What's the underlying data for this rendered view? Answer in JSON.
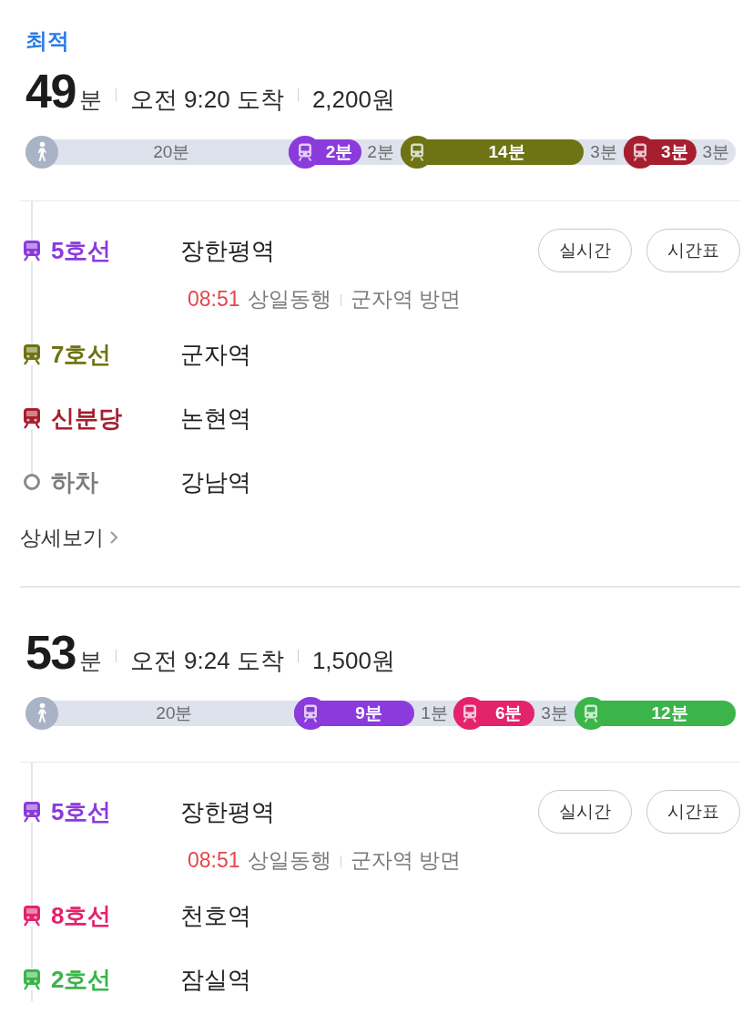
{
  "routes": [
    {
      "label": "최적",
      "duration": "49",
      "unit": "분",
      "arrival": "오전 9:20 도착",
      "fare": "2,200원",
      "segments": [
        {
          "kind": "walk",
          "time": "20분"
        },
        {
          "kind": "ride",
          "time": "2분",
          "color": "#8b3bdb"
        },
        {
          "kind": "transfer",
          "time": "2분"
        },
        {
          "kind": "ride",
          "time": "14분",
          "color": "#6e7314"
        },
        {
          "kind": "transfer",
          "time": "3분"
        },
        {
          "kind": "ride",
          "time": "3분",
          "color": "#a61f2e"
        },
        {
          "kind": "transfer",
          "time": "3분"
        }
      ],
      "steps": [
        {
          "kind": "board",
          "line": "5호선",
          "color": "#8b3bdb",
          "station": "장한평역",
          "detail": {
            "time": "08:51",
            "direction": "상일동행",
            "toward": "군자역 방면"
          },
          "buttons": [
            "실시간",
            "시간표"
          ]
        },
        {
          "kind": "board",
          "line": "7호선",
          "color": "#6e7314",
          "station": "군자역"
        },
        {
          "kind": "board",
          "line": "신분당",
          "color": "#a61f2e",
          "station": "논현역"
        },
        {
          "kind": "alight",
          "line": "하차",
          "station": "강남역"
        }
      ],
      "more_link": "상세보기"
    },
    {
      "duration": "53",
      "unit": "분",
      "arrival": "오전 9:24 도착",
      "fare": "1,500원",
      "segments": [
        {
          "kind": "walk",
          "time": "20분"
        },
        {
          "kind": "ride",
          "time": "9분",
          "color": "#8b3bdb"
        },
        {
          "kind": "transfer",
          "time": "1분"
        },
        {
          "kind": "ride",
          "time": "6분",
          "color": "#e3236b"
        },
        {
          "kind": "transfer",
          "time": "3분"
        },
        {
          "kind": "ride",
          "time": "12분",
          "color": "#3bb54a"
        }
      ],
      "steps": [
        {
          "kind": "board",
          "line": "5호선",
          "color": "#8b3bdb",
          "station": "장한평역",
          "detail": {
            "time": "08:51",
            "direction": "상일동행",
            "toward": "군자역 방면"
          },
          "buttons": [
            "실시간",
            "시간표"
          ]
        },
        {
          "kind": "board",
          "line": "8호선",
          "color": "#e3236b",
          "station": "천호역"
        },
        {
          "kind": "board",
          "line": "2호선",
          "color": "#3bb54a",
          "station": "잠실역"
        }
      ]
    }
  ]
}
